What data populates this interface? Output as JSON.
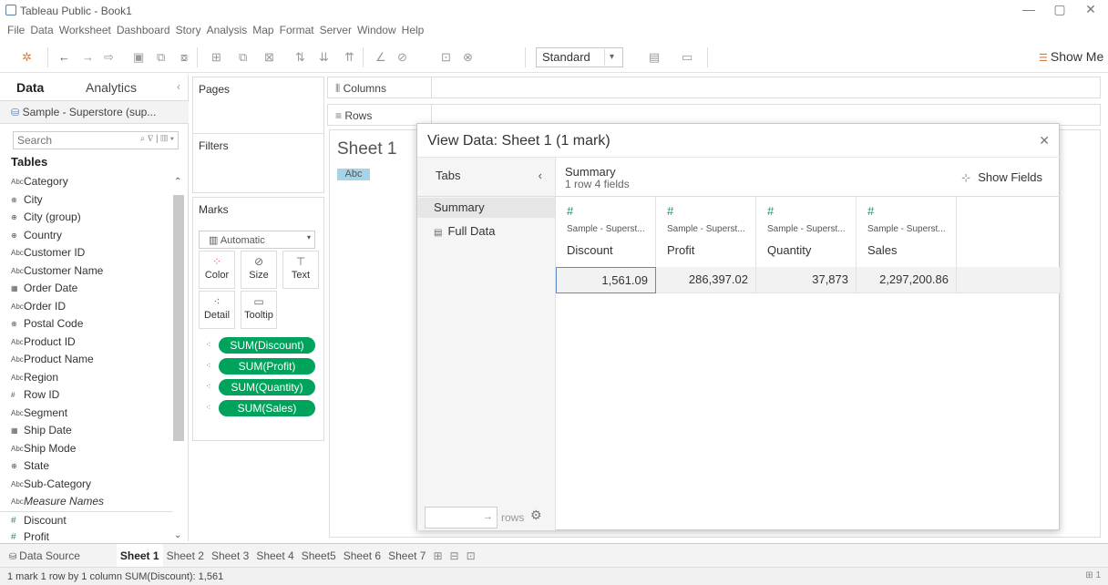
{
  "window": {
    "title": "Tableau Public - Book1",
    "minimize": "—",
    "maximize": "▢",
    "close": "✕"
  },
  "menu": [
    "File",
    "Data",
    "Worksheet",
    "Dashboard",
    "Story",
    "Analysis",
    "Map",
    "Format",
    "Server",
    "Window",
    "Help"
  ],
  "toolbar": {
    "fit_value": "Standard",
    "show_me_label": "Show Me"
  },
  "data_pane": {
    "tab_data": "Data",
    "tab_analytics": "Analytics",
    "datasource_name": "Sample - Superstore (sup...",
    "search_placeholder": "Search",
    "tables_heading": "Tables",
    "fields": [
      {
        "icon": "Abc",
        "label": "Category"
      },
      {
        "icon": "⊕",
        "label": "City"
      },
      {
        "icon": "⊕",
        "label": "City (group)"
      },
      {
        "icon": "⊕",
        "label": "Country"
      },
      {
        "icon": "Abc",
        "label": "Customer ID"
      },
      {
        "icon": "Abc",
        "label": "Customer Name"
      },
      {
        "icon": "▦",
        "label": "Order Date"
      },
      {
        "icon": "Abc",
        "label": "Order ID"
      },
      {
        "icon": "⊕",
        "label": "Postal Code"
      },
      {
        "icon": "Abc",
        "label": "Product ID"
      },
      {
        "icon": "Abc",
        "label": "Product Name"
      },
      {
        "icon": "Abc",
        "label": "Region"
      },
      {
        "icon": "#",
        "label": "Row ID"
      },
      {
        "icon": "Abc",
        "label": "Segment"
      },
      {
        "icon": "▦",
        "label": "Ship Date"
      },
      {
        "icon": "Abc",
        "label": "Ship Mode"
      },
      {
        "icon": "⊕",
        "label": "State"
      },
      {
        "icon": "Abc",
        "label": "Sub-Category"
      },
      {
        "icon": "Abc",
        "label": "Measure Names"
      },
      {
        "icon": "#",
        "label": "Discount"
      },
      {
        "icon": "#",
        "label": "Profit"
      }
    ]
  },
  "cards": {
    "pages": "Pages",
    "filters": "Filters",
    "marks": "Marks",
    "mark_type": "Automatic",
    "mark_buttons": [
      "Color",
      "Size",
      "Text",
      "Detail",
      "Tooltip"
    ],
    "pills": [
      "SUM(Discount)",
      "SUM(Profit)",
      "SUM(Quantity)",
      "SUM(Sales)"
    ]
  },
  "shelves": {
    "columns": "Columns",
    "rows": "Rows"
  },
  "worksheet": {
    "title": "Sheet 1",
    "placeholder": "Abc"
  },
  "dialog": {
    "title": "View Data: Sheet 1 (1 mark)",
    "tabs_heading": "Tabs",
    "tabs": [
      "Summary",
      "Full Data"
    ],
    "summary_heading": "Summary",
    "summary_sub": "1 row  4 fields",
    "show_fields": "Show Fields",
    "rows_label": "rows",
    "columns": [
      {
        "source": "Sample - Superst...",
        "name": "Discount",
        "value": "1,561.09"
      },
      {
        "source": "Sample - Superst...",
        "name": "Profit",
        "value": "286,397.02"
      },
      {
        "source": "Sample - Superst...",
        "name": "Quantity",
        "value": "37,873"
      },
      {
        "source": "Sample - Superst...",
        "name": "Sales",
        "value": "2,297,200.86"
      }
    ]
  },
  "sheet_tabs": {
    "data_source": "Data Source",
    "sheets": [
      "Sheet 1",
      "Sheet 2",
      "Sheet 3",
      "Sheet 4",
      "Sheet5",
      "Sheet 6",
      "Sheet 7"
    ]
  },
  "status": {
    "text": "1 mark   1 row by 1 column    SUM(Discount): 1,561",
    "right": "⊞ 1"
  },
  "colors": {
    "measure_green": "#00a35c",
    "accent_orange": "#e07b39",
    "selection_blue": "#5b8ac9"
  }
}
